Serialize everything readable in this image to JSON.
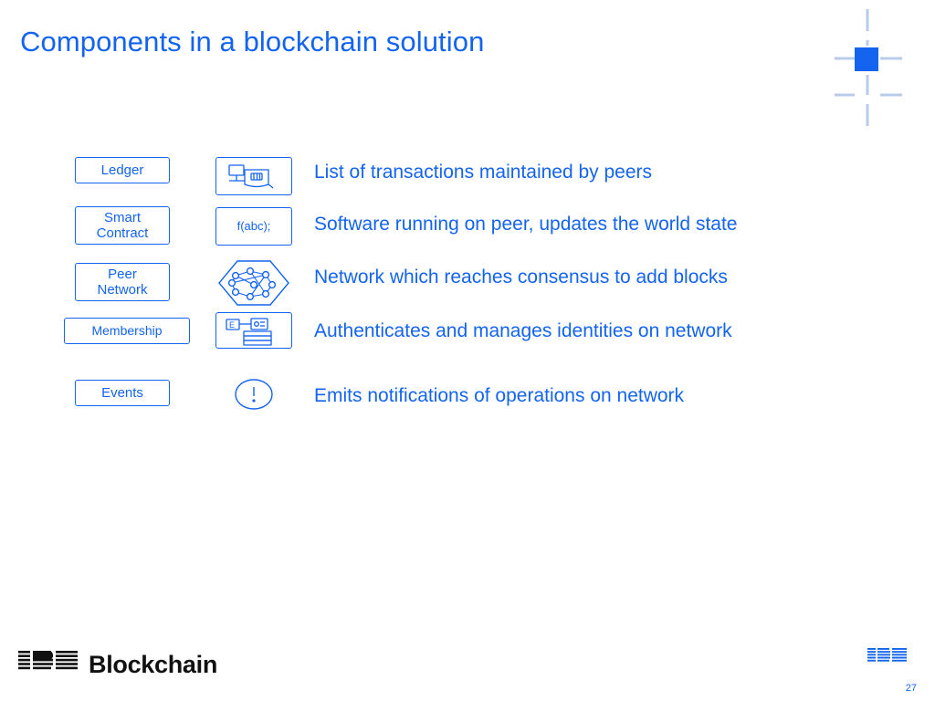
{
  "slide": {
    "title": "Components in a blockchain solution",
    "accent_color": "#1464F0",
    "page_number": "27"
  },
  "rows": [
    {
      "label": "Ledger",
      "label_line2": "",
      "icon": "ledger-document-icon",
      "icon_text": "",
      "description": "List of transactions maintained by peers"
    },
    {
      "label": "Smart",
      "label_line2": "Contract",
      "icon": "code-function-icon",
      "icon_text": "f(abc);",
      "description": "Software running on peer, updates the world state"
    },
    {
      "label": "Peer",
      "label_line2": "Network",
      "icon": "peer-network-hexagon-icon",
      "icon_text": "",
      "description": "Network which reaches consensus to add blocks"
    },
    {
      "label": "Membership",
      "label_line2": "",
      "icon": "membership-identity-cards-icon",
      "icon_text": "",
      "description": "Authenticates and manages identities on network"
    },
    {
      "label": "Events",
      "label_line2": "",
      "icon": "exclamation-alert-icon",
      "icon_text": "",
      "description": "Emits notifications of operations on network"
    }
  ],
  "footer": {
    "brand_prefix": "IBM",
    "brand_name": "Blockchain"
  }
}
